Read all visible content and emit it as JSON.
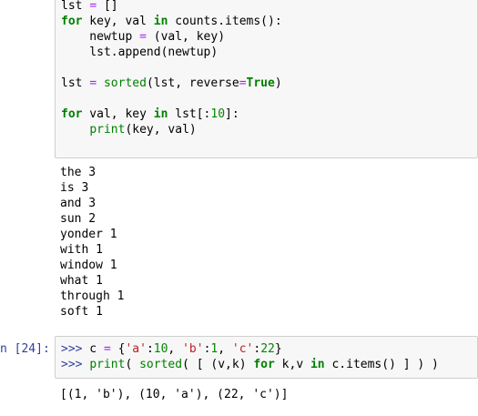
{
  "cell1": {
    "lines": [
      "lst = []",
      "for key, val in counts.items():",
      "    newtup = (val, key)",
      "    lst.append(newtup)",
      "",
      "lst = sorted(lst, reverse=True)",
      "",
      "for val, key in lst[:10]:",
      "    print(key, val)"
    ]
  },
  "output1": {
    "lines": [
      "the 3",
      "is 3",
      "and 3",
      "sun 2",
      "yonder 1",
      "with 1",
      "window 1",
      "what 1",
      "through 1",
      "soft 1"
    ]
  },
  "cell2": {
    "prompt": "n [24]:",
    "lines": [
      ">>> c = {'a':10, 'b':1, 'c':22}",
      ">>> print( sorted( [ (v,k) for k,v in c.items() ] ) )"
    ]
  },
  "output2": {
    "text": "[(1, 'b'), (10, 'a'), (22, 'c')]"
  },
  "colors": {
    "keyword": "#008000",
    "operator": "#aa22ff",
    "string": "#ba2121",
    "prompt": "#303f9f",
    "cell_bg": "#f7f7f7"
  }
}
